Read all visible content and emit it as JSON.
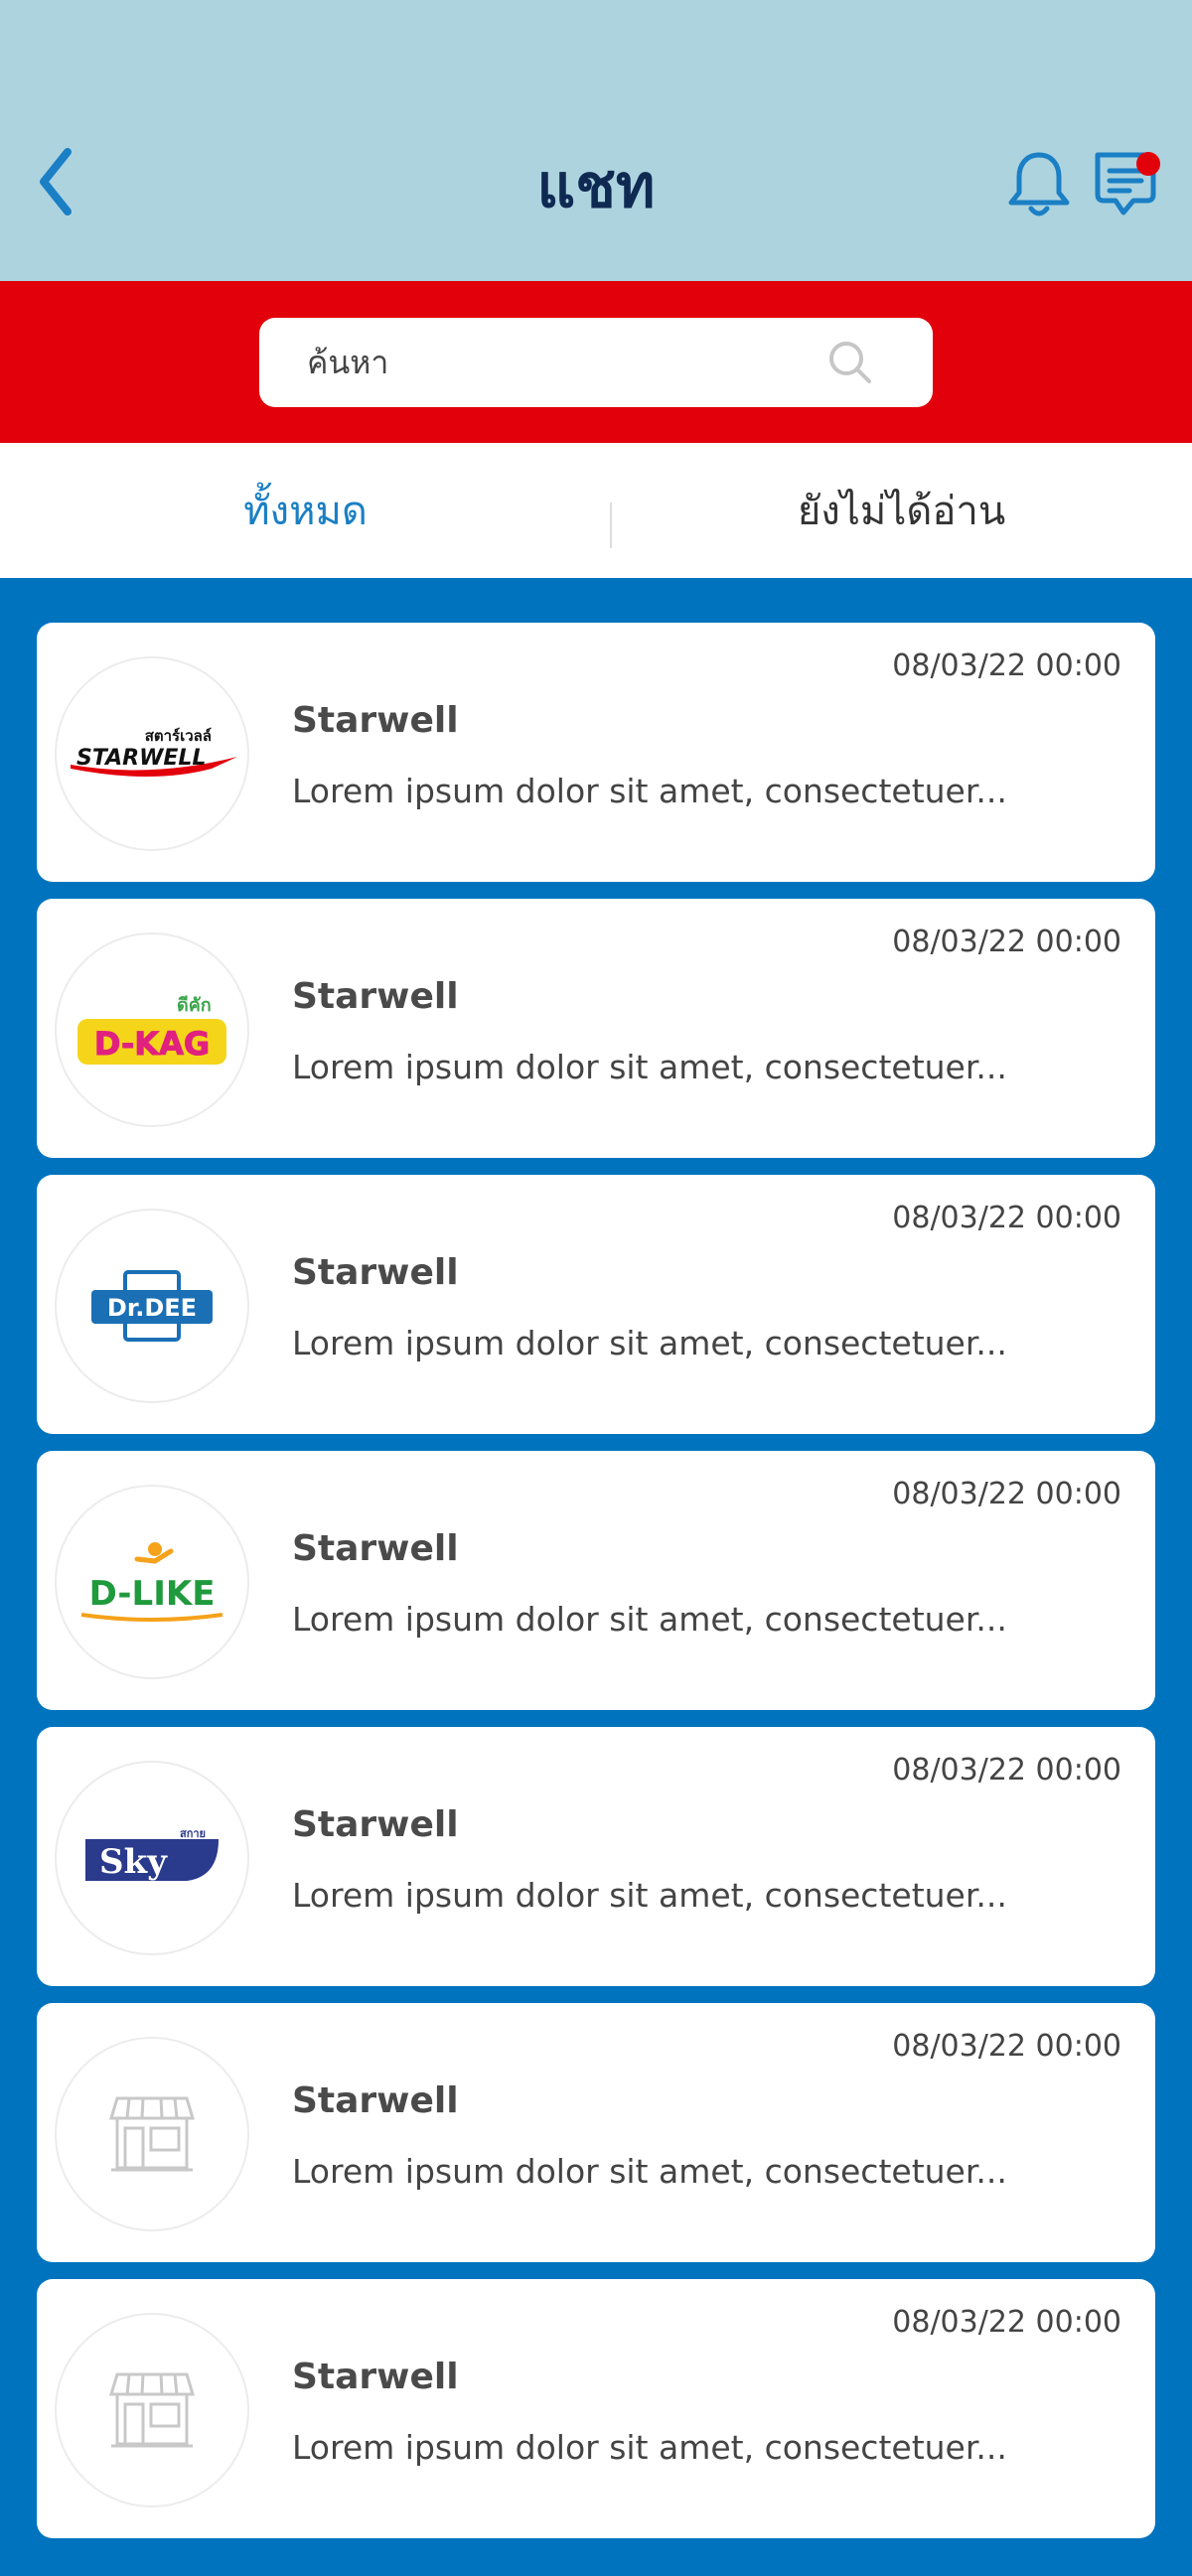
{
  "header": {
    "title": "แชท",
    "back_icon": "chevron-left-icon",
    "bell_icon": "bell-icon",
    "chat_icon": "chat-bubble-icon",
    "has_unread_badge": true,
    "colors": {
      "background": "#add3df",
      "title": "#0f2a52",
      "icons": "#1a7fc4",
      "badge": "#e2000b"
    }
  },
  "search": {
    "placeholder": "ค้นหา",
    "icon": "search-icon",
    "band_color": "#e2000b"
  },
  "tabs": [
    {
      "label": "ทั้งหมด",
      "active": true
    },
    {
      "label": "ยังไม่ได้อ่าน",
      "active": false
    }
  ],
  "list_background": "#0073bf",
  "chats": [
    {
      "logo": "starwell-logo",
      "logo_text": "STARWELL",
      "logo_text_th": "สตาร์เวลล์",
      "time": "08/03/22  00:00",
      "name": "Starwell",
      "preview": "Lorem ipsum dolor sit amet, consectetuer..."
    },
    {
      "logo": "d-kag-logo",
      "logo_text": "D-KAG",
      "logo_text_th": "ดีคัก",
      "time": "08/03/22  00:00",
      "name": "Starwell",
      "preview": "Lorem ipsum dolor sit amet, consectetuer..."
    },
    {
      "logo": "dr-dee-logo",
      "logo_text": "Dr.DEE",
      "time": "08/03/22  00:00",
      "name": "Starwell",
      "preview": "Lorem ipsum dolor sit amet, consectetuer..."
    },
    {
      "logo": "d-like-logo",
      "logo_text": "D-LIKE",
      "time": "08/03/22  00:00",
      "name": "Starwell",
      "preview": "Lorem ipsum dolor sit amet, consectetuer..."
    },
    {
      "logo": "sky-logo",
      "logo_text": "Sky",
      "logo_text_th": "สกาย",
      "time": "08/03/22  00:00",
      "name": "Starwell",
      "preview": "Lorem ipsum dolor sit amet, consectetuer..."
    },
    {
      "logo": "shop-placeholder-icon",
      "time": "08/03/22  00:00",
      "name": "Starwell",
      "preview": "Lorem ipsum dolor sit amet, consectetuer..."
    },
    {
      "logo": "shop-placeholder-icon",
      "time": "08/03/22  00:00",
      "name": "Starwell",
      "preview": "Lorem ipsum dolor sit amet, consectetuer..."
    }
  ]
}
